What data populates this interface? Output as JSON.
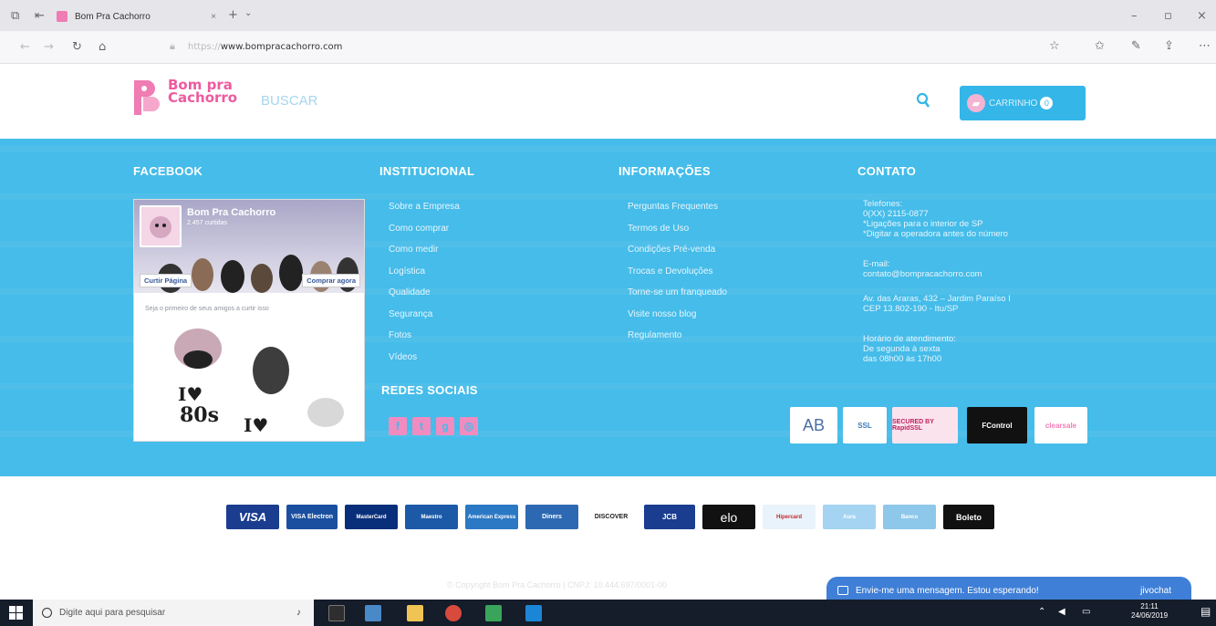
{
  "browser": {
    "tab_title": "Bom Pra Cachorro",
    "url_protocol": "https://",
    "url_domain": "www.bompracachorro.com"
  },
  "header": {
    "logo_line1": "Bom pra",
    "logo_line2": "Cachorro",
    "search_placeholder": "BUSCAR",
    "cart_label": "CARRINHO",
    "cart_count": "0"
  },
  "footer": {
    "facebook_title": "FACEBOOK",
    "facebook_widget": {
      "page_name": "Bom Pra Cachorro",
      "likes": "2.457 curtidas",
      "like_button": "Curtir Página",
      "buy_button": "Comprar agora",
      "friends_text": "Seja o primeiro de seus amigos a curtir isso",
      "post_text_1": "I♥",
      "post_text_2": "80s",
      "post_text_3": "I♥"
    },
    "institucional_title": "INSTITUCIONAL",
    "institucional_links": [
      "Sobre a Empresa",
      "Como comprar",
      "Como medir",
      "Logística",
      "Qualidade",
      "Segurança",
      "Fotos",
      "Vídeos"
    ],
    "redes_title": "REDES SOCIAIS",
    "informacoes_title": "INFORMAÇÕES",
    "informacoes_links": [
      "Perguntas Frequentes",
      "Termos de Uso",
      "Condições Pré-venda",
      "Trocas e Devoluções",
      "Torne-se um franqueado",
      "Visite nosso blog",
      "Regulamento"
    ],
    "contato_title": "CONTATO",
    "contato": {
      "phone_label": "Telefones:",
      "phone": "0(XX) 2115-0877",
      "phone_note1": "*Ligações para o interior de SP",
      "phone_note2": "*Digitar a operadora antes do número",
      "email_label": "E-mail:",
      "email": "contato@bompracachorro.com",
      "address1": "Av. das Araras, 432 – Jardim Paraíso I",
      "address2": "CEP 13.802-190 - Itu/SP",
      "hours_label": "Horário de atendimento:",
      "hours1": "De segunda à sexta",
      "hours2": "das 08h00 às 17h00"
    },
    "seals": [
      "AB",
      "SSL",
      "SECURED BY RapidSSL",
      "FControl",
      "clearsale"
    ],
    "payments": [
      "VISA",
      "VISA Electron",
      "MasterCard",
      "Maestro",
      "American Express",
      "Diners",
      "DISCOVER",
      "JCB",
      "elo",
      "Hipercard",
      "Aura",
      "Banco",
      "Boleto"
    ],
    "copyright": "© Copyright Bom Pra Cachorro | CNPJ: 10.444.697/0001-00"
  },
  "chat": {
    "message": "Envie-me uma mensagem. Estou esperando!",
    "brand": "jivochat"
  },
  "taskbar": {
    "search_placeholder": "Digite aqui para pesquisar",
    "time": "21:11",
    "date": "24/06/2019"
  },
  "colors": {
    "footer_blue": "#45bce9",
    "brand_pink": "#ee5aa0",
    "cart_blue": "#34b6e8"
  }
}
